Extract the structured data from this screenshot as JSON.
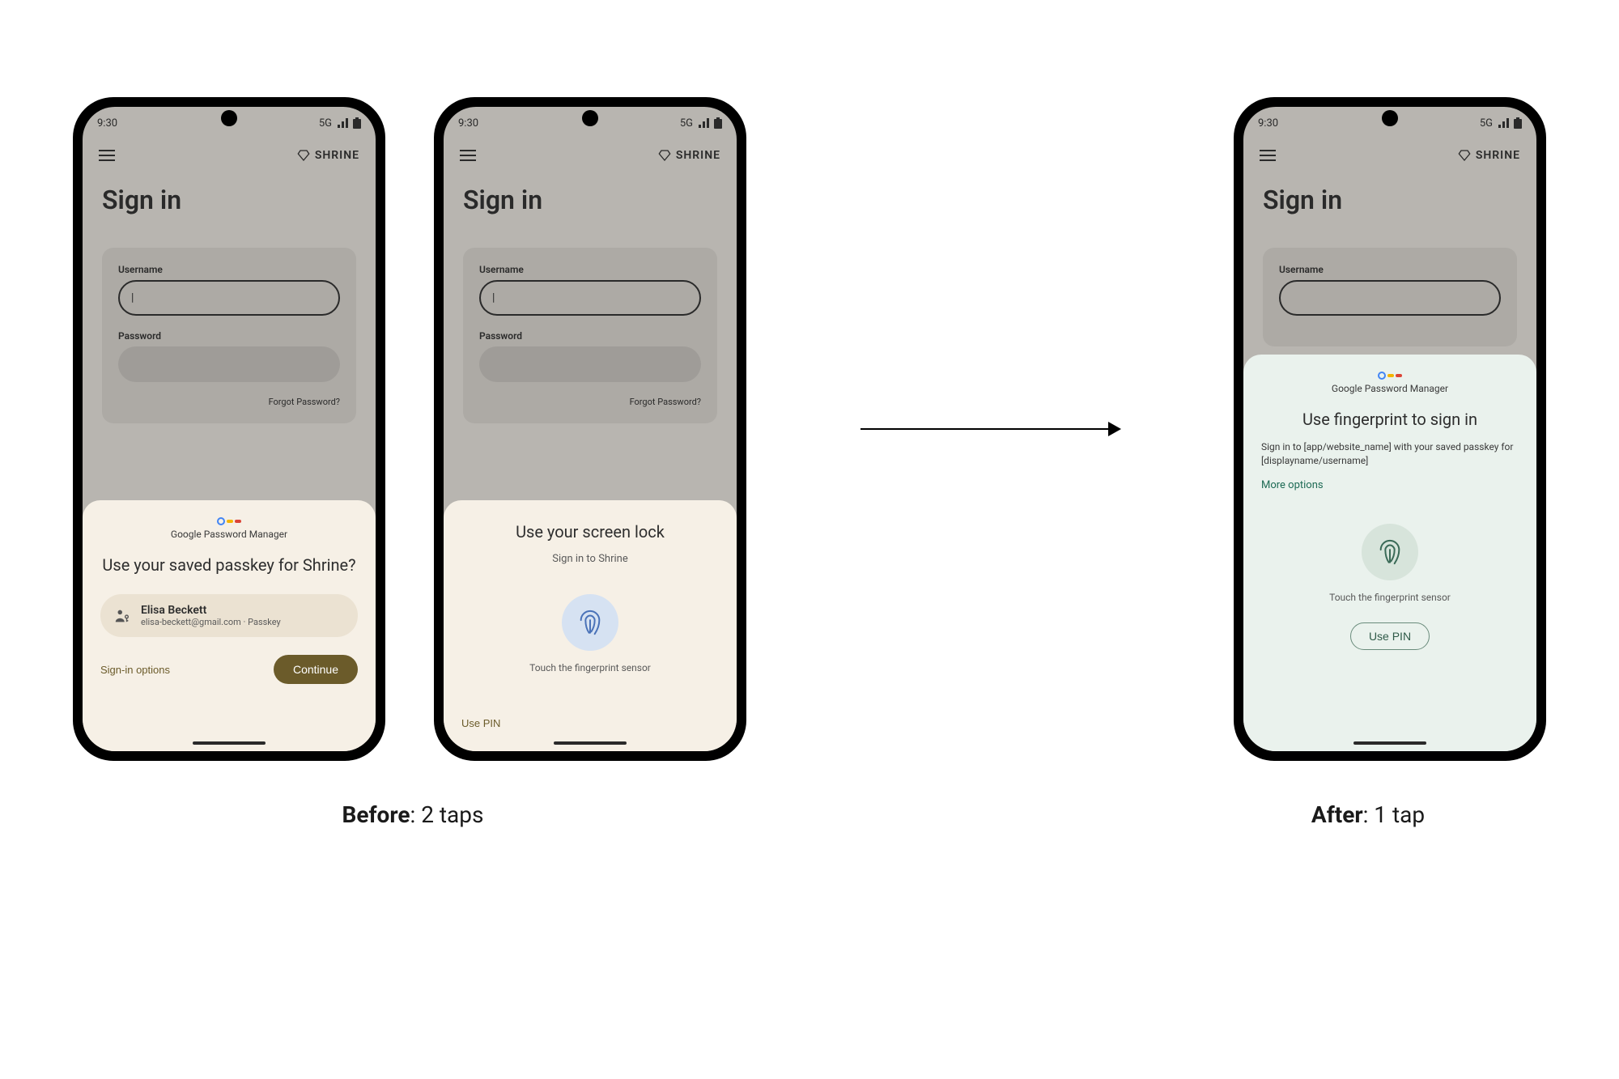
{
  "status": {
    "time": "9:30",
    "network": "5G"
  },
  "app": {
    "brand": "SHRINE",
    "signin_title": "Sign in",
    "username_label": "Username",
    "password_label": "Password",
    "username_value": "|",
    "forgot": "Forgot Password?"
  },
  "sheet1": {
    "gpm_label": "Google Password Manager",
    "title": "Use your saved passkey for Shrine?",
    "account_name": "Elisa Beckett",
    "account_meta": "elisa-beckett@gmail.com · Passkey",
    "signin_options": "Sign-in options",
    "continue": "Continue"
  },
  "sheet2": {
    "title": "Use your screen lock",
    "subtitle": "Sign in to Shrine",
    "fp_text": "Touch the fingerprint sensor",
    "use_pin": "Use PIN"
  },
  "sheet3": {
    "gpm_label": "Google Password Manager",
    "title": "Use fingerprint to sign in",
    "body": "Sign in to [app/website_name] with your saved passkey for [displayname/username]",
    "more_options": "More options",
    "fp_text": "Touch the fingerprint sensor",
    "use_pin": "Use PIN"
  },
  "captions": {
    "before_bold": "Before",
    "before_rest": ": 2 taps",
    "after_bold": "After",
    "after_rest": ": 1 tap"
  }
}
